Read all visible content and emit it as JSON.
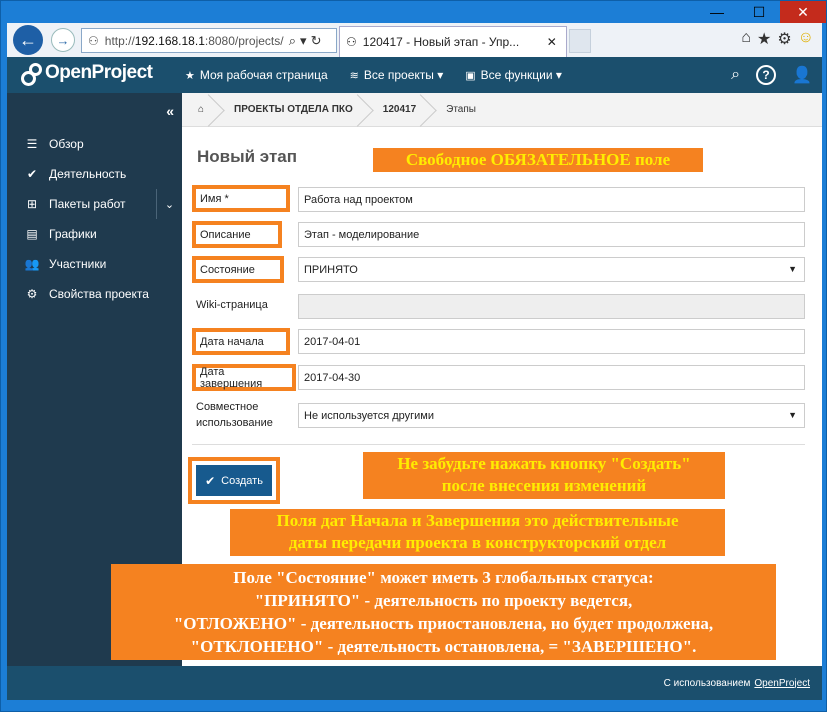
{
  "browser": {
    "url_prefix": "http://",
    "url_host": "192.168.18.1",
    "url_rest": ":8080/projects/",
    "tab_title": "120417 - Новый этап - Упр..."
  },
  "header": {
    "logo": "OpenProject",
    "nav": [
      "Моя рабочая страница",
      "Все проекты",
      "Все функции"
    ],
    "help": "?"
  },
  "sidebar": {
    "items": [
      {
        "label": "Обзор",
        "icon": "list-icon"
      },
      {
        "label": "Деятельность",
        "icon": "check-icon"
      },
      {
        "label": "Пакеты работ",
        "icon": "hierarchy-icon"
      },
      {
        "label": "Графики",
        "icon": "timeline-icon"
      },
      {
        "label": "Участники",
        "icon": "group-icon"
      },
      {
        "label": "Свойства проекта",
        "icon": "gear-icon"
      }
    ]
  },
  "breadcrumb": [
    "ПРОЕКТЫ ОТДЕЛА ПКО",
    "120417",
    "Этапы"
  ],
  "form": {
    "title": "Новый этап",
    "name_label": "Имя *",
    "name_value": "Работа над проектом",
    "desc_label": "Описание",
    "desc_value": "Этап - моделирование",
    "status_label": "Состояние",
    "status_value": "ПРИНЯТО",
    "wiki_label": "Wiki-страница",
    "wiki_value": "",
    "start_label": "Дата начала",
    "start_value": "2017-04-01",
    "end_label": "Дата завершения",
    "end_value": "2017-04-30",
    "sharing_label_1": "Совместное",
    "sharing_label_2": "использование",
    "sharing_value": "Не используется другими",
    "create_button": "Создать"
  },
  "notes": {
    "n1": "Свободное ОБЯЗАТЕЛЬНОЕ поле",
    "n2_l1": "Не забудьте нажать кнопку \"Создать\"",
    "n2_l2": "после внесения изменений",
    "n3_l1": "Поля дат Начала и Завершения это действительные",
    "n3_l2": "даты передачи проекта в конструкторский отдел",
    "n4_l1": "Поле \"Состояние\" может иметь 3 глобальных статуса:",
    "n4_l2": "\"ПРИНЯТО\" - деятельность по проекту ведется,",
    "n4_l3": "\"ОТЛОЖЕНО\" - деятельность приостановлена, но будет продолжена,",
    "n4_l4": "\"ОТКЛОНЕНО\" - деятельность остановлена, = \"ЗАВЕРШЕНО\"."
  },
  "footer": {
    "text": "С использованием",
    "link": "OpenProject"
  },
  "colors": {
    "accent_orange": "#f58220",
    "header_bg": "#1b4f6d",
    "sidebar_bg": "#1f3a4e",
    "button_bg": "#175a8e",
    "note_yellow": "#ffed00"
  }
}
